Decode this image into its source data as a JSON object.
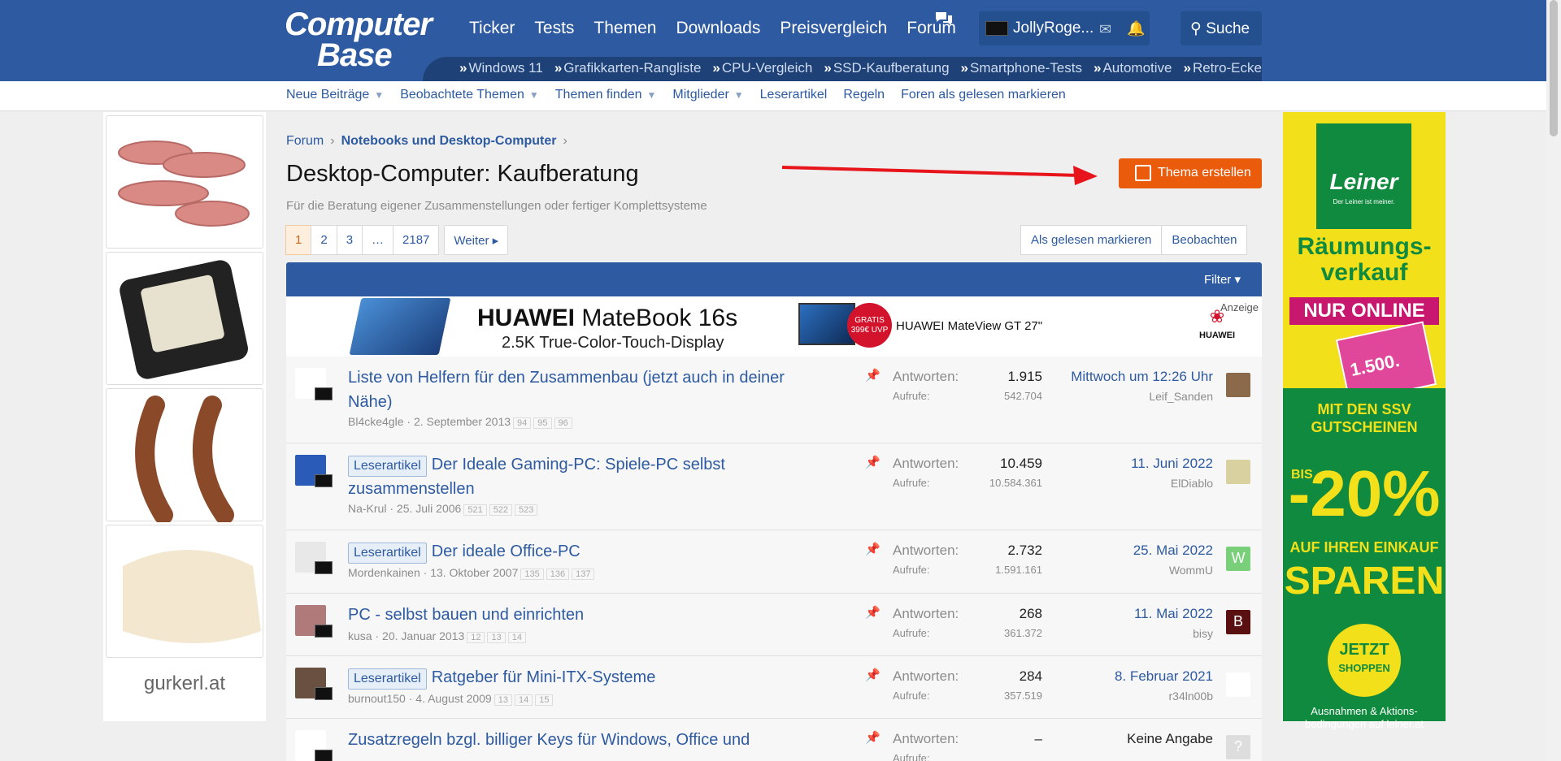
{
  "header": {
    "logo_line1": "Computer",
    "logo_line2": "Base",
    "nav": [
      "Ticker",
      "Tests",
      "Themen",
      "Downloads",
      "Preisvergleich",
      "Forum"
    ],
    "username": "JollyRoge...",
    "search_label": "Suche",
    "sub_links": [
      "Windows 11",
      "Grafikkarten-Rangliste",
      "CPU-Vergleich",
      "SSD-Kaufberatung",
      "Smartphone-Tests",
      "Automotive",
      "Retro-Ecke"
    ],
    "sub_link_prefix": "»"
  },
  "secondary_nav": [
    {
      "label": "Neue Beiträge",
      "caret": true
    },
    {
      "label": "Beobachtete Themen",
      "caret": true
    },
    {
      "label": "Themen finden",
      "caret": true
    },
    {
      "label": "Mitglieder",
      "caret": true
    },
    {
      "label": "Leserartikel",
      "caret": false
    },
    {
      "label": "Regeln",
      "caret": false
    },
    {
      "label": "Foren als gelesen markieren",
      "caret": false
    }
  ],
  "left_ad": {
    "brand": "gurkerl.at"
  },
  "right_ad": {
    "logo": "Leiner",
    "logo_sub": "Der Leiner ist meiner.",
    "headline": "Räumungs-verkauf",
    "online": "NUR ONLINE",
    "coupon": "1.500.",
    "mit_den": "MIT DEN SSV GUTSCHEINEN",
    "bis": "BIS",
    "percent": "-20%",
    "auf": "AUF IHREN EINKAUF",
    "sparen": "SPAREN",
    "jetzt": "JETZT",
    "shoppen": "SHOPPEN",
    "footer": "Ausnahmen & Aktions-bedingungen auf leiner.at"
  },
  "breadcrumb": {
    "root": "Forum",
    "current": "Notebooks und Desktop-Computer"
  },
  "page": {
    "title": "Desktop-Computer: Kaufberatung",
    "description": "Für die Beratung eigener Zusammenstellungen oder fertiger Komplettsysteme",
    "create_button": "Thema erstellen"
  },
  "pager": {
    "pages": [
      "1",
      "2",
      "3",
      "…",
      "2187"
    ],
    "next": "Weiter"
  },
  "actions": {
    "mark_read": "Als gelesen markieren",
    "watch": "Beobachten"
  },
  "filter_label": "Filter",
  "banner": {
    "brand_bold": "HUAWEI",
    "brand_rest": " MateBook 16s",
    "subline": "2.5K True-Color-Touch-Display",
    "gratis": "GRATIS 399€ UVP",
    "monitor": "HUAWEI MateView GT 27\"",
    "logo_text": "HUAWEI",
    "anzeige": "Anzeige"
  },
  "threads": [
    {
      "label": "",
      "title_line1": "Liste von Helfern für den Zusammenbau (jetzt auch in deiner",
      "title_line2": "Nähe)",
      "author": "Bl4cke4gle",
      "date": "2. September 2013",
      "pages": [
        "94",
        "95",
        "96"
      ],
      "replies": "1.915",
      "views": "542.704",
      "last_date": "Mittwoch um 12:26 Uhr",
      "last_user": "Leif_Sanden",
      "avatar_color": "#ffffff",
      "last_av_color": "#8a6a4a",
      "last_av_letter": ""
    },
    {
      "label": "Leserartikel",
      "title_line1": "Der Ideale Gaming-PC: Spiele-PC selbst",
      "title_line2": "zusammenstellen",
      "author": "Na-Krul",
      "date": "25. Juli 2006",
      "pages": [
        "521",
        "522",
        "523"
      ],
      "replies": "10.459",
      "views": "10.584.361",
      "last_date": "11. Juni 2022",
      "last_user": "ElDiablo",
      "avatar_color": "#2b5bb8",
      "last_av_color": "#d9d2a0",
      "last_av_letter": ""
    },
    {
      "label": "Leserartikel",
      "title_line1": "Der ideale Office-PC",
      "title_line2": "",
      "author": "Mordenkainen",
      "date": "13. Oktober 2007",
      "pages": [
        "135",
        "136",
        "137"
      ],
      "replies": "2.732",
      "views": "1.591.161",
      "last_date": "25. Mai 2022",
      "last_user": "WommU",
      "avatar_color": "#e8e8e8",
      "last_av_color": "#7ad07a",
      "last_av_letter": "W"
    },
    {
      "label": "",
      "title_line1": "PC - selbst bauen und einrichten",
      "title_line2": "",
      "author": "kusa",
      "date": "20. Januar 2013",
      "pages": [
        "12",
        "13",
        "14"
      ],
      "replies": "268",
      "views": "361.372",
      "last_date": "11. Mai 2022",
      "last_user": "bisy",
      "avatar_color": "#b07a7a",
      "last_av_color": "#5a1010",
      "last_av_letter": "B"
    },
    {
      "label": "Leserartikel",
      "title_line1": "Ratgeber für Mini-ITX-Systeme",
      "title_line2": "",
      "author": "burnout150",
      "date": "4. August 2009",
      "pages": [
        "13",
        "14",
        "15"
      ],
      "replies": "284",
      "views": "357.519",
      "last_date": "8. Februar 2021",
      "last_user": "r34ln00b",
      "avatar_color": "#6a5040",
      "last_av_color": "#ffffff",
      "last_av_letter": ""
    },
    {
      "label": "",
      "title_line1": "Zusatzregeln bzgl. billiger Keys für Windows, Office und",
      "title_line2": "",
      "author": "",
      "date": "",
      "pages": [],
      "replies": "–",
      "views": "",
      "last_date": "Keine Angabe",
      "last_user": "",
      "avatar_color": "#ffffff",
      "last_av_color": "#dddddd",
      "last_av_letter": "?"
    }
  ],
  "stat_labels": {
    "replies": "Antworten:",
    "views": "Aufrufe:"
  }
}
